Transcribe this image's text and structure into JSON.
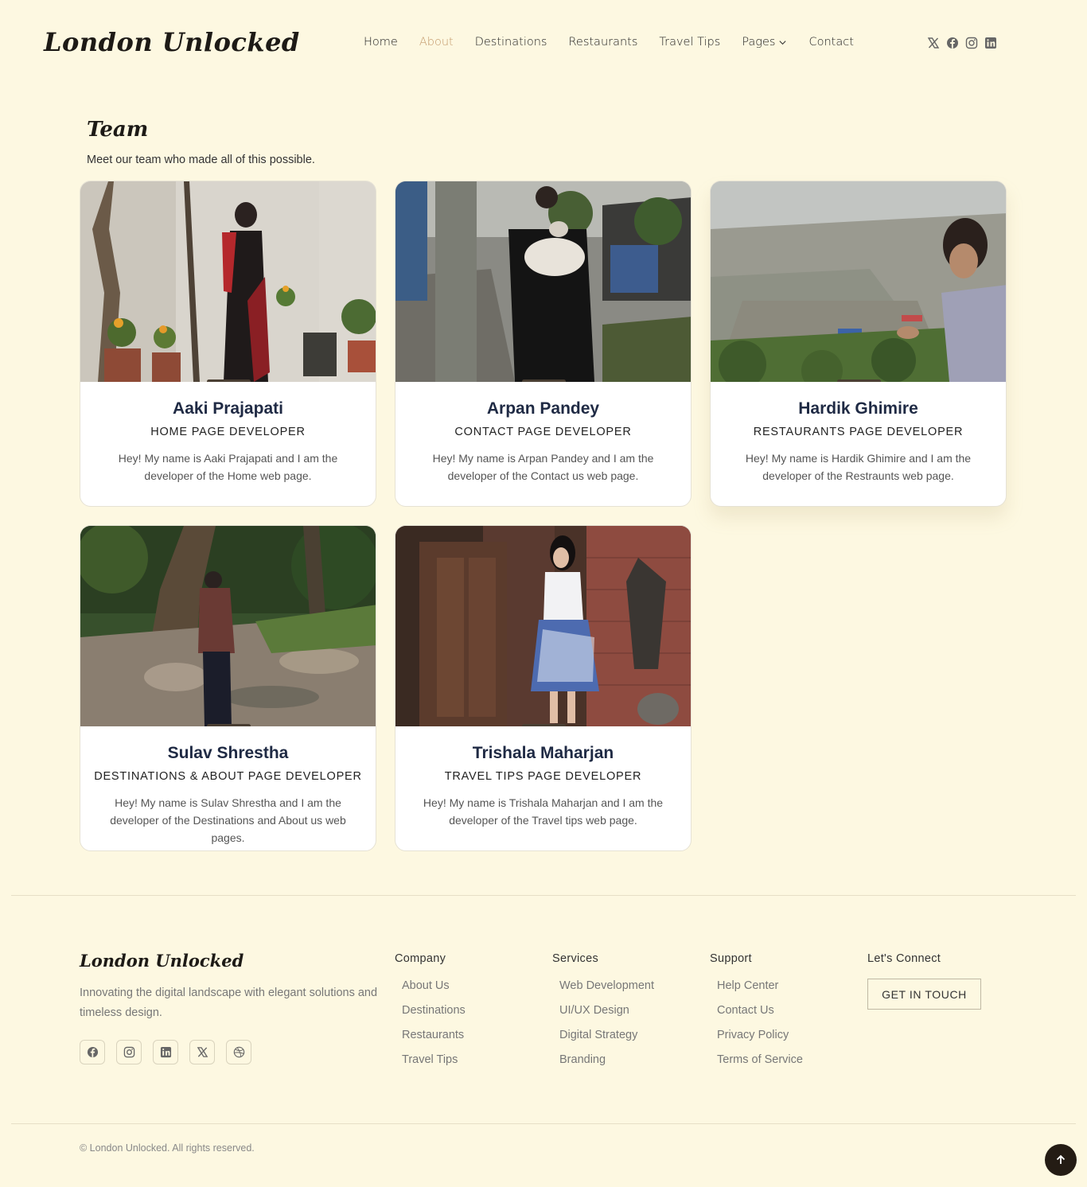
{
  "header": {
    "logo": "London Unlocked",
    "nav": [
      {
        "label": "Home"
      },
      {
        "label": "About"
      },
      {
        "label": "Destinations"
      },
      {
        "label": "Restaurants"
      },
      {
        "label": "Travel Tips"
      },
      {
        "label": "Pages"
      },
      {
        "label": "Contact"
      }
    ],
    "active_nav": "About",
    "social_icons": [
      "x-icon",
      "facebook-icon",
      "instagram-icon",
      "linkedin-icon"
    ]
  },
  "team": {
    "title": "Team",
    "subtitle": "Meet our team who made all of this possible.",
    "members": [
      {
        "name": "Aaki Prajapati",
        "role": "HOME PAGE DEVELOPER",
        "bio": "Hey! My name is Aaki Prajapati and I am the developer of the Home web page."
      },
      {
        "name": "Arpan Pandey",
        "role": "CONTACT PAGE DEVELOPER",
        "bio": "Hey! My name is Arpan Pandey and I am the developer of the Contact us web page."
      },
      {
        "name": "Hardik Ghimire",
        "role": "RESTAURANTS PAGE DEVELOPER",
        "bio": "Hey! My name is Hardik Ghimire and I am the developer of the Restraunts web page."
      },
      {
        "name": "Sulav Shrestha",
        "role": "DESTINATIONS & ABOUT PAGE DEVELOPER",
        "bio": "Hey! My name is Sulav Shrestha and I am the developer of the Destinations and About us web pages."
      },
      {
        "name": "Trishala Maharjan",
        "role": "TRAVEL TIPS PAGE DEVELOPER",
        "bio": "Hey! My name is Trishala Maharjan and I am the developer of the Travel tips web page."
      }
    ]
  },
  "footer": {
    "logo": "London Unlocked",
    "description": "Innovating the digital landscape with elegant solutions and timeless design.",
    "social_icons": [
      "facebook-icon",
      "instagram-icon",
      "linkedin-icon",
      "x-icon",
      "dribbble-icon"
    ],
    "columns": [
      {
        "title": "Company",
        "links": [
          "About Us",
          "Destinations",
          "Restaurants",
          "Travel Tips"
        ]
      },
      {
        "title": "Services",
        "links": [
          "Web Development",
          "UI/UX Design",
          "Digital Strategy",
          "Branding"
        ]
      },
      {
        "title": "Support",
        "links": [
          "Help Center",
          "Contact Us",
          "Privacy Policy",
          "Terms of Service"
        ]
      }
    ],
    "connect": {
      "title": "Let's Connect",
      "button": "GET IN TOUCH"
    },
    "copyright": "© London Unlocked. All rights reserved."
  },
  "colors": {
    "background": "#fdf8e1",
    "accent": "#c49a6c",
    "dark": "#241c14",
    "name": "#1f2a44"
  }
}
